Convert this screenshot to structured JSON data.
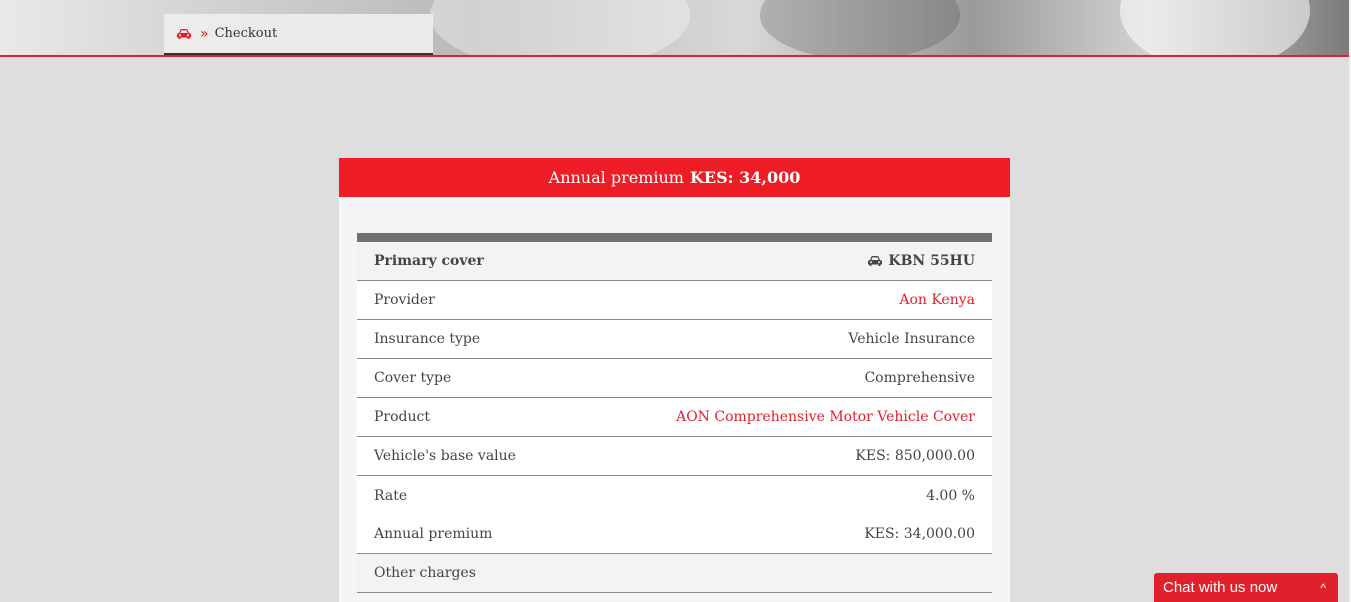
{
  "breadcrumb": {
    "icon": "car-icon",
    "separator": "»",
    "current": "Checkout"
  },
  "header": {
    "prefix": "Annual premium",
    "amount": "KES: 34,000"
  },
  "table": {
    "head": {
      "label": "Primary cover",
      "icon": "car-icon",
      "plate": "KBN 55HU"
    },
    "rows": [
      {
        "label": "Provider",
        "value": "Aon Kenya"
      },
      {
        "label": "Insurance type",
        "value": "Vehicle Insurance"
      },
      {
        "label": "Cover type",
        "value": "Comprehensive"
      },
      {
        "label": "Product",
        "value": "AON Comprehensive Motor Vehicle Cover"
      },
      {
        "label": "Vehicle's base value",
        "value": "KES: 850,000.00"
      },
      {
        "label": "Rate",
        "value": "4.00 %"
      },
      {
        "label": "Annual premium",
        "value": "KES: 34,000.00"
      },
      {
        "label": "Other charges",
        "value": ""
      }
    ]
  },
  "chat": {
    "label": "Chat with us now",
    "caret": "^"
  },
  "colors": {
    "accent": "#ee1c25",
    "link": "#e0202a",
    "background": "#dedede"
  }
}
